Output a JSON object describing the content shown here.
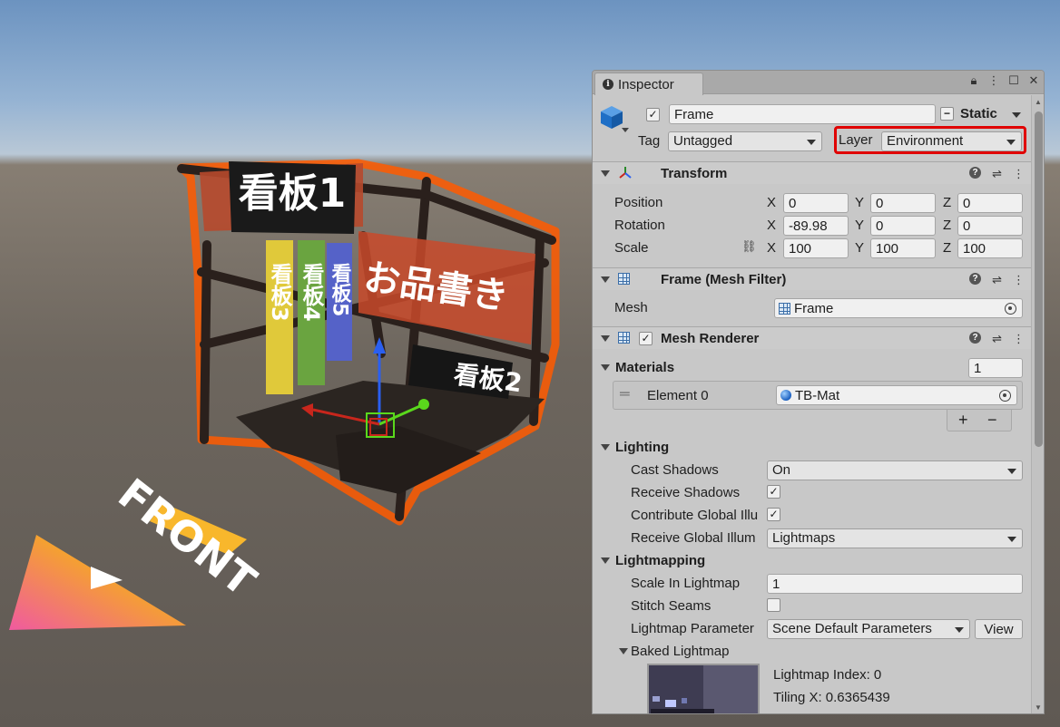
{
  "scene": {
    "sign_main": "看板1",
    "sign_2": "看板2",
    "banner_3": "看板3",
    "banner_4": "看板4",
    "banner_5": "看板5",
    "banner_red": "お品書き",
    "front_label": "FRONT"
  },
  "inspector": {
    "tab_label": "Inspector",
    "object": {
      "active": true,
      "name": "Frame",
      "static_label": "Static",
      "tag_label": "Tag",
      "tag_value": "Untagged",
      "layer_label": "Layer",
      "layer_value": "Environment"
    },
    "transform": {
      "title": "Transform",
      "position_label": "Position",
      "rotation_label": "Rotation",
      "scale_label": "Scale",
      "x": "X",
      "y": "Y",
      "z": "Z",
      "position": [
        "0",
        "0",
        "0"
      ],
      "rotation": [
        "-89.98",
        "0",
        "0"
      ],
      "scale": [
        "100",
        "100",
        "100"
      ]
    },
    "mesh_filter": {
      "title": "Frame (Mesh Filter)",
      "mesh_label": "Mesh",
      "mesh_value": "Frame"
    },
    "mesh_renderer": {
      "title": "Mesh Renderer",
      "materials_label": "Materials",
      "materials_count": "1",
      "element_label": "Element 0",
      "element_value": "TB-Mat",
      "add": "+",
      "remove": "−",
      "lighting_label": "Lighting",
      "cast_shadows_label": "Cast Shadows",
      "cast_shadows_value": "On",
      "receive_shadows_label": "Receive Shadows",
      "contribute_gi_label": "Contribute Global Illu",
      "receive_gi_label": "Receive Global Illum",
      "receive_gi_value": "Lightmaps",
      "lightmapping_label": "Lightmapping",
      "scale_in_lightmap_label": "Scale In Lightmap",
      "scale_in_lightmap_value": "1",
      "stitch_seams_label": "Stitch Seams",
      "lightmap_params_label": "Lightmap Parameter",
      "lightmap_params_value": "Scene Default Parameters",
      "view_button": "View",
      "baked_lightmap_label": "Baked Lightmap",
      "lightmap_index": "Lightmap Index: 0",
      "tiling_x": "Tiling X: 0.6365439"
    }
  }
}
